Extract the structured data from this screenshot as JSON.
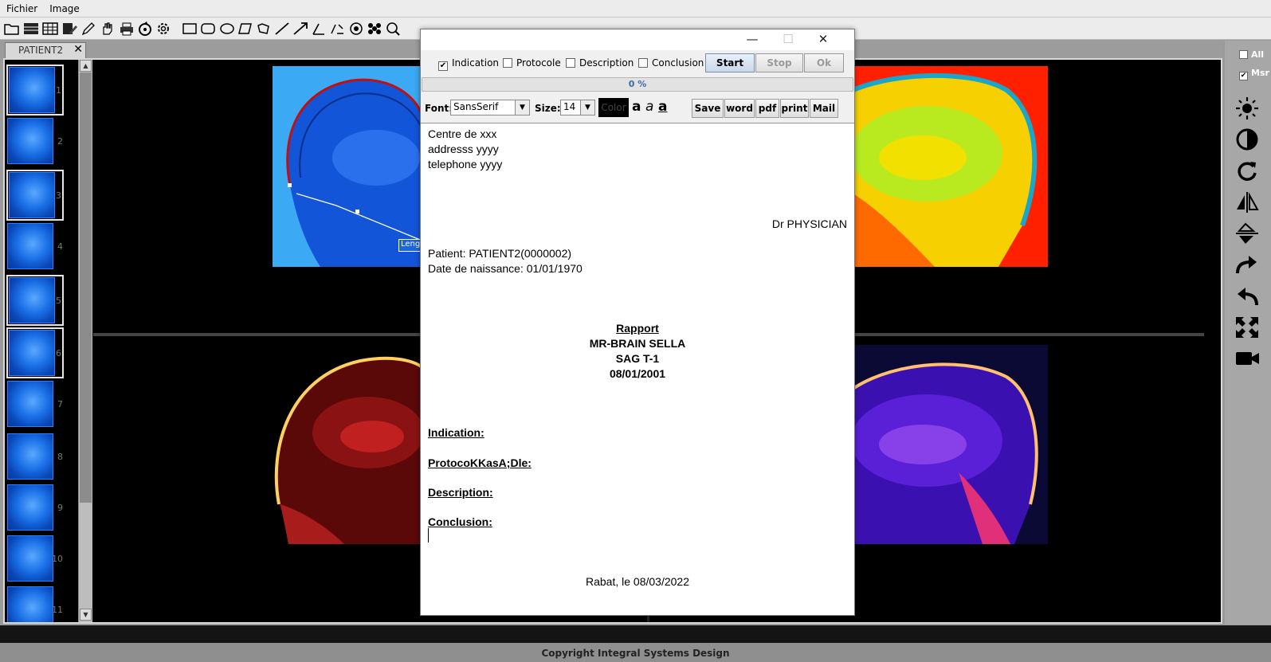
{
  "menu": {
    "fichier": "Fichier",
    "image": "Image"
  },
  "toolbar": {
    "icons": [
      "open-folder-icon",
      "list-icon",
      "table-icon",
      "edit-report-icon",
      "pen-icon",
      "hand-icon",
      "print-icon",
      "burn-icon",
      "gear-icon",
      "rectangle-icon",
      "rounded-rect-icon",
      "ellipse-icon",
      "polygon-icon",
      "freehand-icon",
      "line-icon",
      "arrow-icon",
      "angle-icon",
      "cobb-icon",
      "point-icon",
      "cluster-icon",
      "magnify-icon"
    ]
  },
  "tab": {
    "label": "PATIENT2",
    "close": "✕"
  },
  "thumbnails": [
    "1",
    "2",
    "3",
    "4",
    "5",
    "6",
    "7",
    "8",
    "9",
    "10",
    "11"
  ],
  "measurement_label": "Leng",
  "right_tools": {
    "all_label": "All",
    "msr_label": "Msr",
    "icons": [
      "brightness-icon",
      "contrast-icon",
      "rotate-icon",
      "flip-horizontal-icon",
      "flip-vertical-icon",
      "redo-icon",
      "undo-icon",
      "fullscreen-icon",
      "video-icon"
    ]
  },
  "footer": {
    "copyright": "Copyright Integral Systems Design"
  },
  "dialog": {
    "minimize": "—",
    "maximize": "☐",
    "close": "✕",
    "checkboxes": {
      "indication": "Indication",
      "protocole": "Protocole",
      "description": "Description",
      "conclusion": "Conclusion"
    },
    "buttons": {
      "start": "Start",
      "stop": "Stop",
      "ok": "Ok"
    },
    "progress": "0 %",
    "font_label": "Font:",
    "font_value": "SansSerif",
    "size_label": "Size:",
    "size_value": "14",
    "color_label": "Color",
    "format": {
      "bold": "a",
      "italic": "a",
      "underline": "a"
    },
    "actions": {
      "save": "Save",
      "word": "word",
      "pdf": "pdf",
      "print": "print",
      "mail": "Mail"
    },
    "document": {
      "line1": "Centre de xxx",
      "line2": "addresss yyyy",
      "line3": "telephone yyyy",
      "physician": "Dr PHYSICIAN",
      "patient": "Patient: PATIENT2(0000002)",
      "birth": "Date de naissance: 01/01/1970",
      "title": "Rapport",
      "exam": "MR-BRAIN SELLA",
      "series": "SAG T-1",
      "date": "08/01/2001",
      "indication": "Indication:",
      "protocole": "ProtocoKKasA;Dle:",
      "description": "Description:",
      "conclusion": "Conclusion:",
      "signature": "Rabat, le 08/03/2022"
    }
  },
  "colors": {
    "accent": "#3b6aa8",
    "viewer_bg": "#000000"
  }
}
